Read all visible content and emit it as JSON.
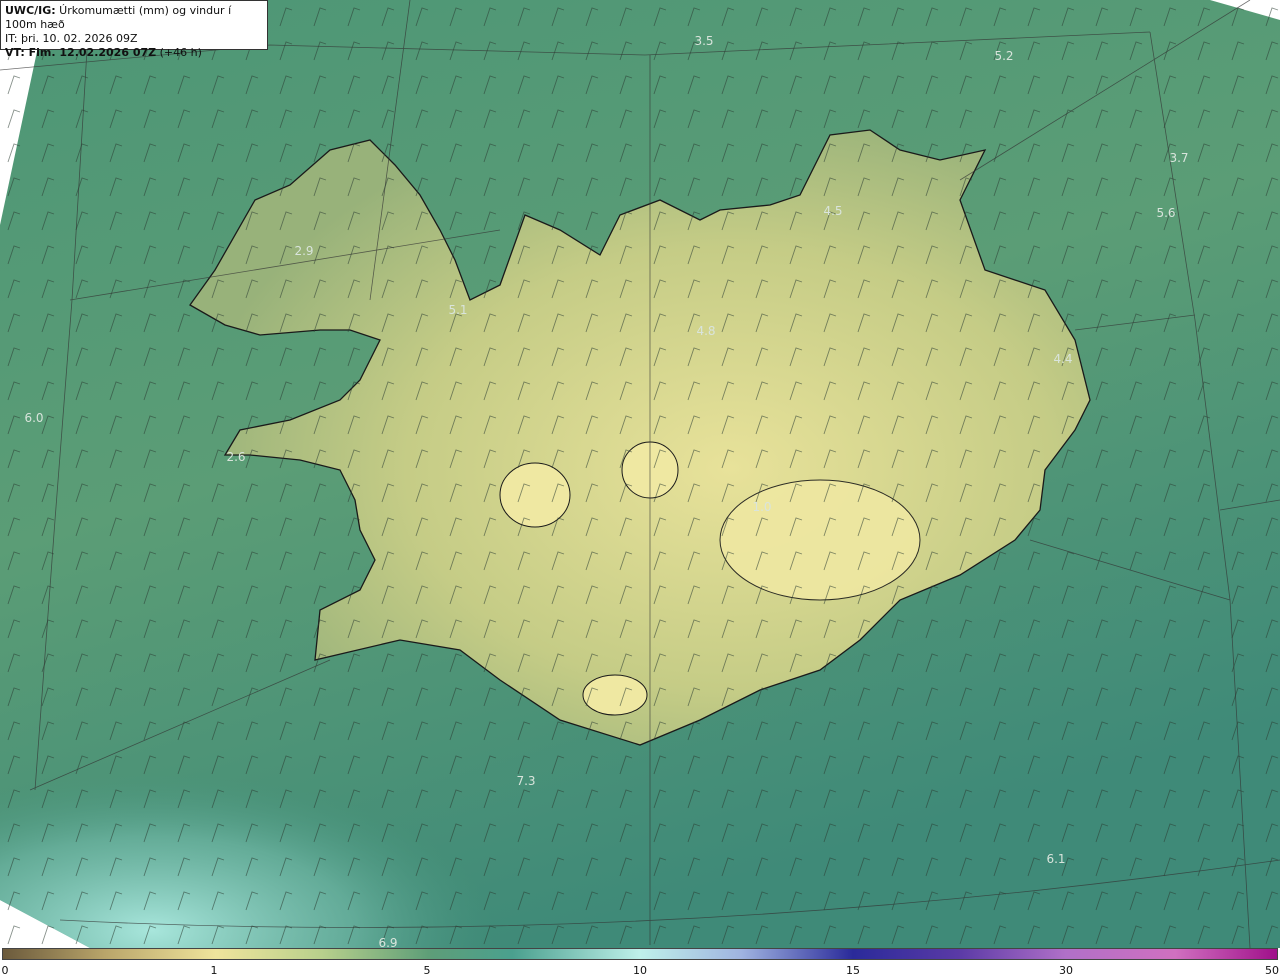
{
  "header": {
    "line1_bold": "UWC/IG:",
    "line1_rest": " Úrkomumætti (mm) og vindur í 100m hæð",
    "line2_bold": "IT:",
    "line2_rest": " þri. 10. 02. 2026 09Z",
    "line3_bold": "VT: Fim. 12.02.2026 07Z",
    "line3_rest": " (+46 h)"
  },
  "values": [
    {
      "id": "v1",
      "text": "3.5"
    },
    {
      "id": "v2",
      "text": "5.2"
    },
    {
      "id": "v3",
      "text": "3.7"
    },
    {
      "id": "v4",
      "text": "5.6"
    },
    {
      "id": "v5",
      "text": "4.5"
    },
    {
      "id": "v6",
      "text": "2.9"
    },
    {
      "id": "v7",
      "text": "5.1"
    },
    {
      "id": "v8",
      "text": "4.8"
    },
    {
      "id": "v9",
      "text": "4.4"
    },
    {
      "id": "v10",
      "text": "6.0"
    },
    {
      "id": "v11",
      "text": "2.6"
    },
    {
      "id": "v12",
      "text": "1.0"
    },
    {
      "id": "v13",
      "text": "7.3"
    },
    {
      "id": "v14",
      "text": "6.1"
    },
    {
      "id": "v15",
      "text": "6.9"
    }
  ],
  "colorbar": {
    "ticks": [
      "0",
      "1",
      "5",
      "10",
      "15",
      "30",
      "50"
    ]
  },
  "colors": {
    "ocean_deep": "#3d8a70",
    "ocean_light": "#9fe3d6",
    "land_low": "#c9cf86",
    "land_high": "#e6e39a",
    "coast": "#1a1a1a"
  }
}
